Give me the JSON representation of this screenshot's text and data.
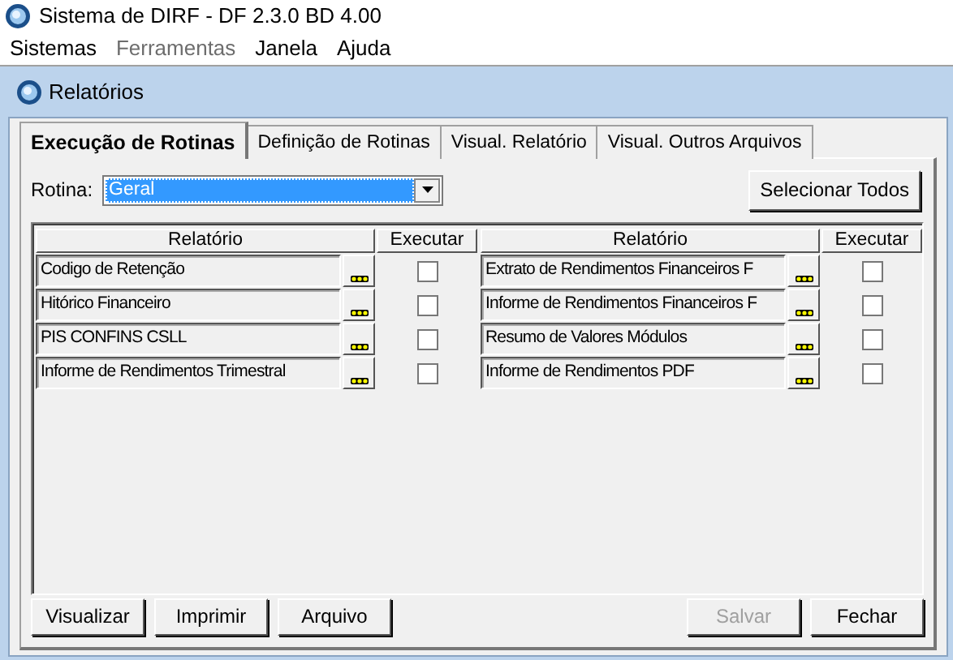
{
  "window": {
    "title": "Sistema de DIRF -  DF 2.3.0 BD 4.00"
  },
  "menu": [
    {
      "label": "Sistemas",
      "disabled": false
    },
    {
      "label": "Ferramentas",
      "disabled": true
    },
    {
      "label": "Janela",
      "disabled": false
    },
    {
      "label": "Ajuda",
      "disabled": false
    }
  ],
  "child_window": {
    "title": "Relatórios"
  },
  "tabs": [
    {
      "label": "Execução de Rotinas",
      "selected": true
    },
    {
      "label": "Definição de Rotinas",
      "selected": false
    },
    {
      "label": "Visual. Relatório",
      "selected": false
    },
    {
      "label": "Visual. Outros Arquivos",
      "selected": false
    }
  ],
  "rotina": {
    "label": "Rotina:",
    "value": "Geral"
  },
  "select_all_button": "Selecionar Todos",
  "grids": [
    {
      "columns": [
        "Relatório",
        "Executar"
      ],
      "rows": [
        {
          "report": "Codigo de Retenção",
          "checked": false
        },
        {
          "report": "Hitórico Financeiro",
          "checked": false
        },
        {
          "report": "PIS CONFINS CSLL",
          "checked": false
        },
        {
          "report": "Informe de Rendimentos Trimestral",
          "checked": false
        }
      ]
    },
    {
      "columns": [
        "Relatório",
        "Executar"
      ],
      "rows": [
        {
          "report": "Extrato de Rendimentos Financeiros F",
          "checked": false
        },
        {
          "report": "Informe de Rendimentos Financeiros F",
          "checked": false
        },
        {
          "report": "Resumo de Valores Módulos",
          "checked": false
        },
        {
          "report": "Informe de Rendimentos PDF",
          "checked": false
        }
      ]
    }
  ],
  "buttons_left": [
    {
      "label": "Visualizar",
      "disabled": false
    },
    {
      "label": "Imprimir",
      "disabled": false
    },
    {
      "label": "Arquivo",
      "disabled": false
    }
  ],
  "buttons_right": [
    {
      "label": "Salvar",
      "disabled": true
    },
    {
      "label": "Fechar",
      "disabled": false
    }
  ]
}
